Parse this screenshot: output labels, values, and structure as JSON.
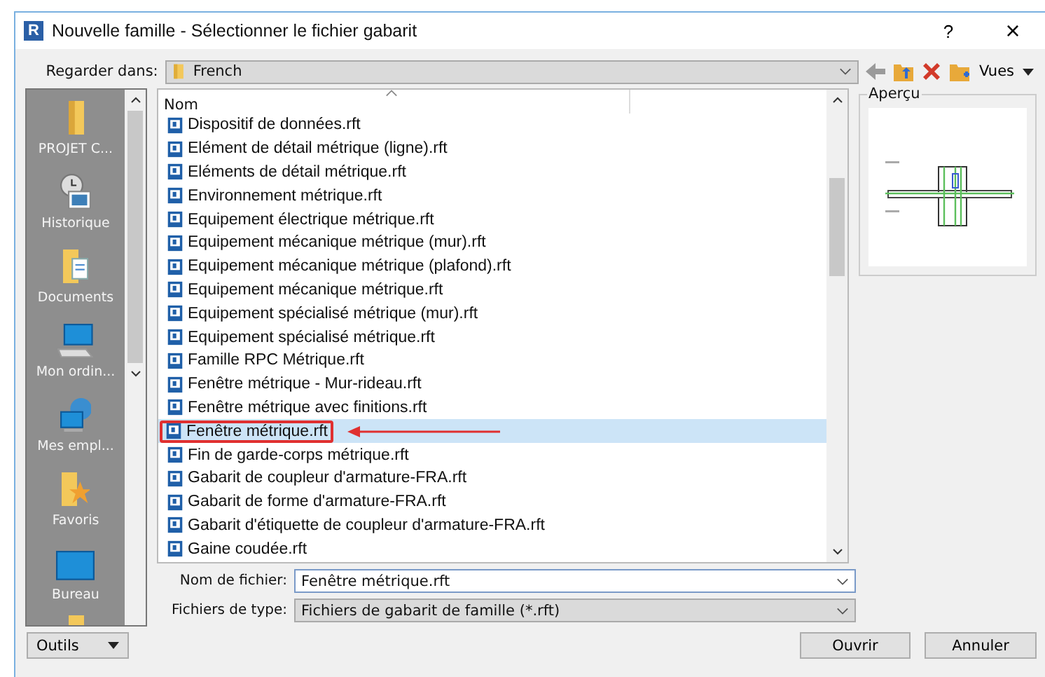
{
  "window": {
    "icon_letter": "R",
    "title": "Nouvelle famille - Sélectionner le fichier gabarit",
    "help": "?",
    "close": "×"
  },
  "look_in": {
    "label": "Regarder dans:",
    "value": "French"
  },
  "toolbar": {
    "views": "Vues"
  },
  "sidebar": {
    "items": [
      {
        "label": "PROJET C..."
      },
      {
        "label": "Historique"
      },
      {
        "label": "Documents"
      },
      {
        "label": "Mon ordin..."
      },
      {
        "label": "Mes empl..."
      },
      {
        "label": "Favoris"
      },
      {
        "label": "Bureau"
      }
    ]
  },
  "file_list": {
    "columns": [
      "Nom"
    ],
    "rows": [
      {
        "name": "Dispositif de données.rft",
        "selected": false,
        "highlighted": false
      },
      {
        "name": "Elément de détail métrique (ligne).rft",
        "selected": false,
        "highlighted": false
      },
      {
        "name": "Eléments de détail métrique.rft",
        "selected": false,
        "highlighted": false
      },
      {
        "name": "Environnement métrique.rft",
        "selected": false,
        "highlighted": false
      },
      {
        "name": "Equipement électrique métrique.rft",
        "selected": false,
        "highlighted": false
      },
      {
        "name": "Equipement mécanique métrique (mur).rft",
        "selected": false,
        "highlighted": false
      },
      {
        "name": "Equipement mécanique métrique (plafond).rft",
        "selected": false,
        "highlighted": false
      },
      {
        "name": "Equipement mécanique métrique.rft",
        "selected": false,
        "highlighted": false
      },
      {
        "name": "Equipement spécialisé métrique (mur).rft",
        "selected": false,
        "highlighted": false
      },
      {
        "name": "Equipement spécialisé métrique.rft",
        "selected": false,
        "highlighted": false
      },
      {
        "name": "Famille RPC Métrique.rft",
        "selected": false,
        "highlighted": false
      },
      {
        "name": "Fenêtre métrique - Mur-rideau.rft",
        "selected": false,
        "highlighted": false
      },
      {
        "name": "Fenêtre métrique avec finitions.rft",
        "selected": false,
        "highlighted": false
      },
      {
        "name": "Fenêtre métrique.rft",
        "selected": true,
        "highlighted": true
      },
      {
        "name": "Fin de garde-corps métrique.rft",
        "selected": false,
        "highlighted": false
      },
      {
        "name": "Gabarit de coupleur d'armature-FRA.rft",
        "selected": false,
        "highlighted": false
      },
      {
        "name": "Gabarit de forme d'armature-FRA.rft",
        "selected": false,
        "highlighted": false
      },
      {
        "name": "Gabarit d'étiquette de coupleur d'armature-FRA.rft",
        "selected": false,
        "highlighted": false
      },
      {
        "name": "Gaine coudée.rft",
        "selected": false,
        "highlighted": false
      }
    ]
  },
  "preview": {
    "title": "Aperçu"
  },
  "file_name": {
    "label": "Nom de fichier:",
    "value": "Fenêtre métrique.rft"
  },
  "file_type": {
    "label": "Fichiers de type:",
    "value": "Fichiers de gabarit de famille  (*.rft)"
  },
  "buttons": {
    "tools": "Outils",
    "open": "Ouvrir",
    "cancel": "Annuler"
  }
}
